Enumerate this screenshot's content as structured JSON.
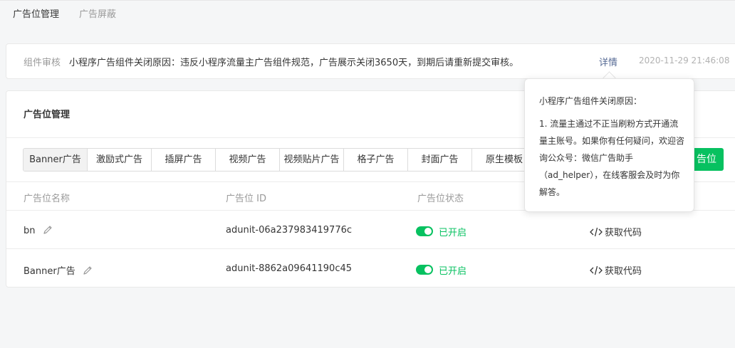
{
  "top_tabs": [
    "广告位管理",
    "广告屏蔽"
  ],
  "notice": {
    "label": "组件审核",
    "message": "小程序广告组件关闭原因：违反小程序流量主广告组件规范，广告展示关闭3650天，到期后请重新提交审核。",
    "detail_link": "详情",
    "timestamp": "2020-11-29 21:46:08"
  },
  "panel": {
    "title": "广告位管理",
    "ad_types": [
      "Banner广告",
      "激励式广告",
      "插屏广告",
      "视频广告",
      "视频贴片广告",
      "格子广告",
      "封面广告",
      "原生模板"
    ],
    "add_button_label": "告位",
    "columns": [
      "广告位名称",
      "广告位 ID",
      "广告位状态"
    ],
    "rows": [
      {
        "name": "bn",
        "id": "adunit-06a237983419776c",
        "status": "已开启",
        "action": "获取代码"
      },
      {
        "name": "Banner广告",
        "id": "adunit-8862a09641190c45",
        "status": "已开启",
        "action": "获取代码"
      }
    ]
  },
  "popover": {
    "title": "小程序广告组件关闭原因：",
    "body": "1. 流量主通过不正当刷粉方式开通流量主账号。如果你有任何疑问，欢迎咨询公众号：微信广告助手（ad_helper），在线客服会及时为你解答。"
  },
  "colors": {
    "accent_green": "#07c160",
    "link_blue": "#576b95"
  }
}
